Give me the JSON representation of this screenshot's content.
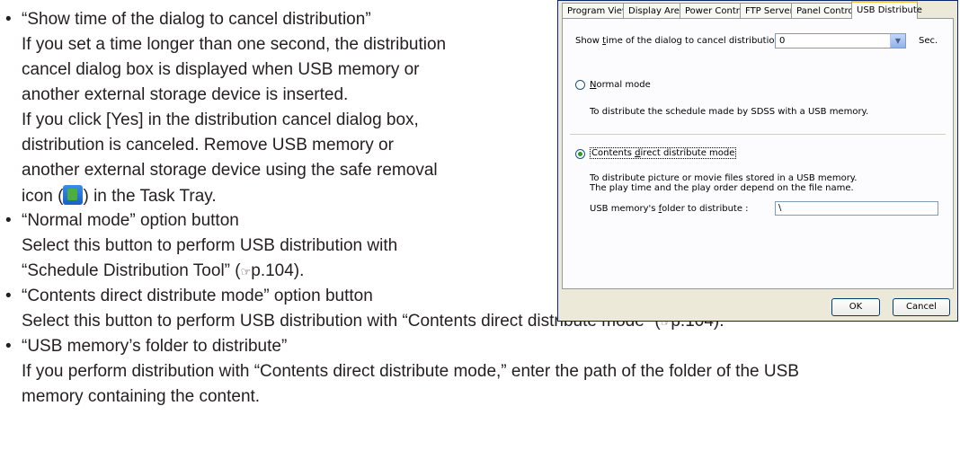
{
  "doc": {
    "bullet_char": "•",
    "show_time_title": "“Show time of the dialog to cancel distribution”",
    "show_time_p1": "If you set a time longer than one second, the distribution",
    "show_time_p2": "cancel dialog box is displayed when USB memory or",
    "show_time_p3": "another external storage device is inserted.",
    "show_time_p4": "If you click [Yes] in the distribution cancel dialog box,",
    "show_time_p5": "distribution is canceled.  Remove USB memory or",
    "show_time_p6": "another external storage device using the safe removal",
    "show_time_p7a": "icon (",
    "show_time_p7b": ") in the Task Tray.",
    "normal_title": "“Normal mode” option button",
    "normal_p1": "Select this button to perform USB distribution with",
    "normal_p2a": "“Schedule Distribution Tool” (",
    "normal_ref_symbol": "☞",
    "normal_p2b": "p.104).",
    "contents_title": "“Contents direct distribute mode” option button",
    "contents_p1a": "Select this button to perform USB distribution with “Contents direct distribute mode” (",
    "contents_ref_symbol": "☞",
    "contents_p1b": "p.104).",
    "folder_title": "“USB memory’s folder to distribute”",
    "folder_p1": "If you perform distribution with “Contents direct distribute mode,” enter the path of the folder of the USB",
    "folder_p2": "memory containing the content."
  },
  "dialog": {
    "tabs": [
      "Program Viewer",
      "Display Area",
      "Power Control",
      "FTP Server",
      "Panel Control",
      "USB Distribute"
    ],
    "active_tab": "USB Distribute",
    "show_time_label_pre": "Show ",
    "show_time_label_key": "t",
    "show_time_label_post": "ime of the dialog to cancel distribution:",
    "show_time_value": "0",
    "show_time_unit": "Sec.",
    "normal_mode_key": "N",
    "normal_mode_rest": "ormal mode",
    "normal_mode_selected": false,
    "normal_mode_desc": "To distribute the schedule made by SDSS with a USB memory.",
    "contents_mode_pre": "Contents ",
    "contents_mode_key": "d",
    "contents_mode_post": "irect distribute mode",
    "contents_mode_selected": true,
    "contents_desc_1": "To distribute picture or movie files stored in a USB memory.",
    "contents_desc_2": "The play time and the play order depend on the file name.",
    "folder_label_pre": "USB memory's ",
    "folder_label_key": "f",
    "folder_label_post": "older to distribute :",
    "folder_value": "\\",
    "ok_label": "OK",
    "cancel_label": "Cancel"
  }
}
